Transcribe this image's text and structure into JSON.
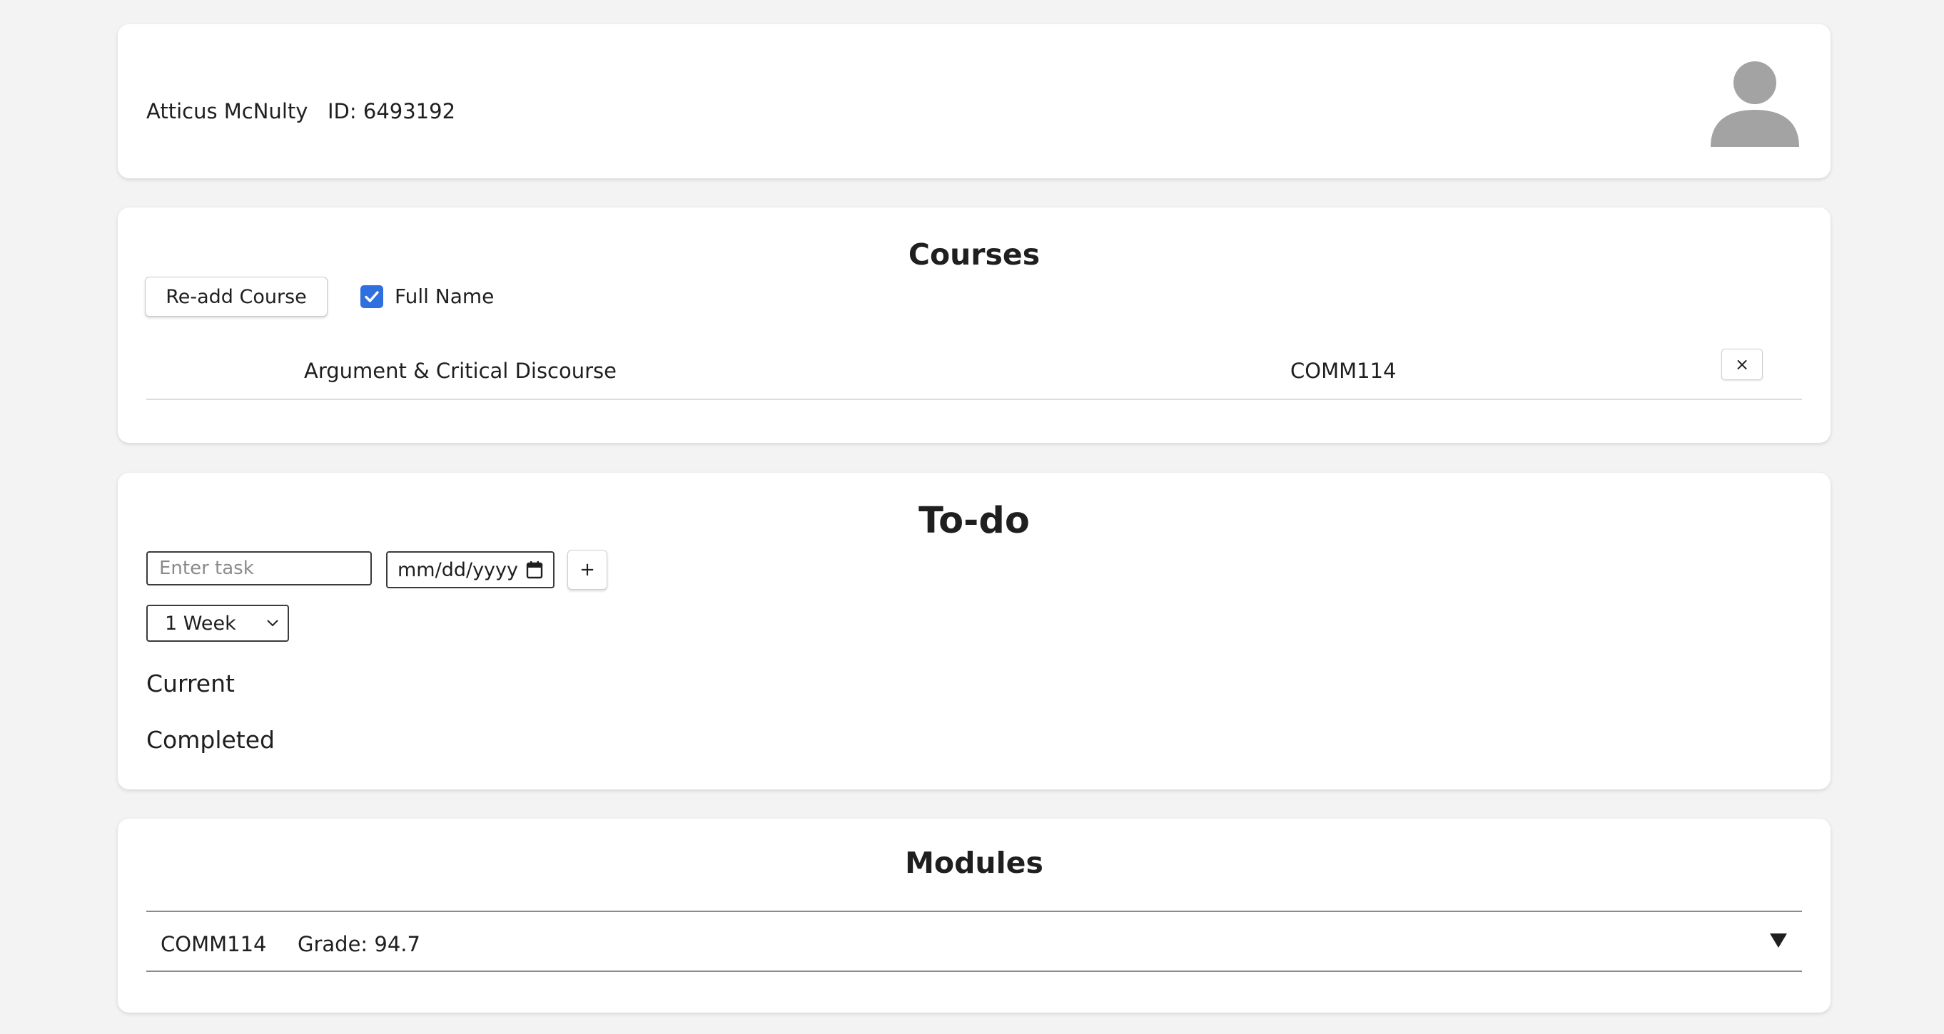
{
  "profile": {
    "name": "Atticus McNulty",
    "id_label": "ID: 6493192",
    "avatar_icon": "user-silhouette-icon"
  },
  "courses": {
    "title": "Courses",
    "readd_label": "Re-add Course",
    "full_name_label": "Full Name",
    "full_name_checked": true,
    "items": [
      {
        "name": "Argument & Critical Discourse",
        "code": "COMM114",
        "remove_label": "×"
      }
    ]
  },
  "todo": {
    "title": "To-do",
    "task_placeholder": "Enter task",
    "date_placeholder": "mm/dd/yyyy",
    "add_label": "+",
    "range_selected": "1 Week",
    "current_label": "Current",
    "completed_label": "Completed"
  },
  "modules": {
    "title": "Modules",
    "items": [
      {
        "code": "COMM114",
        "grade": "Grade: 94.7",
        "expand_icon": "triangle-down-icon"
      }
    ]
  },
  "colors": {
    "background": "#f3f3f3",
    "card": "#ffffff",
    "checkbox_accent": "#2f6fe0",
    "avatar_gray": "#a3a3a3"
  }
}
